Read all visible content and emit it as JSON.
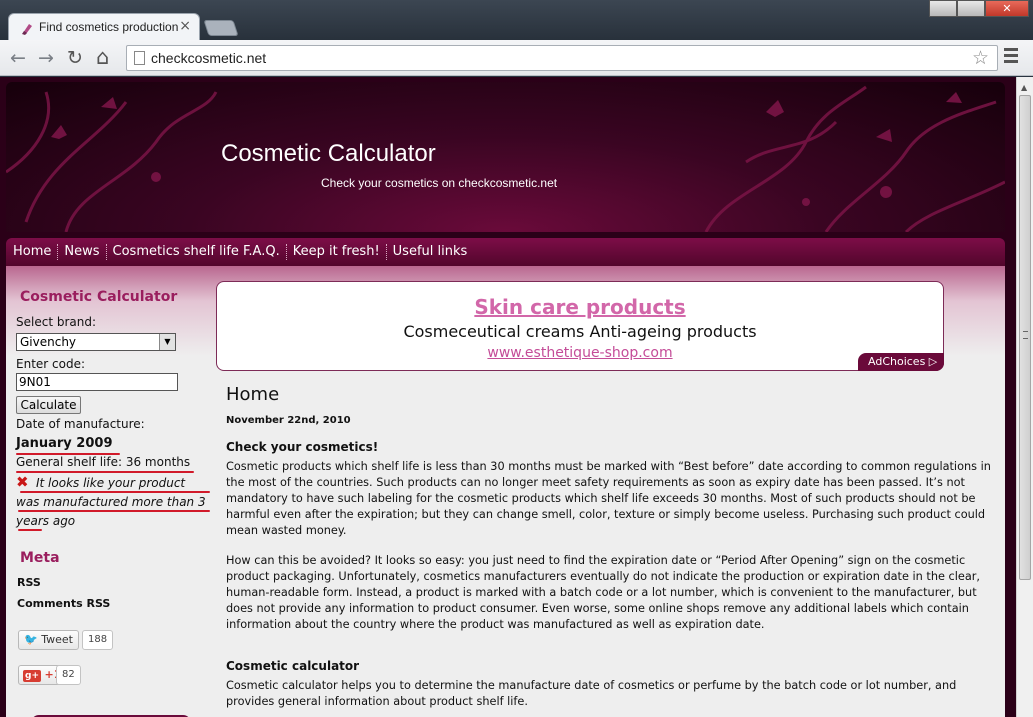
{
  "browser": {
    "tab_title": "Find cosmetics production",
    "tab_close": "×",
    "close_glyph": "✕",
    "url": "checkcosmetic.net",
    "back": "←",
    "forward": "→",
    "reload": "↻",
    "home": "⌂",
    "star": "☆"
  },
  "site": {
    "title": "Cosmetic Calculator",
    "tagline": "Check your cosmetics on checkcosmetic.net",
    "accent": "#9a1e5e"
  },
  "nav": {
    "items": [
      "Home",
      "News",
      "Cosmetics shelf life F.A.Q.",
      "Keep it fresh!",
      "Useful links"
    ]
  },
  "sidebar": {
    "title": "Cosmetic Calculator",
    "brand_label": "Select brand:",
    "brand_value": "Givenchy",
    "code_label": "Enter code:",
    "code_value": "9N01",
    "calculate_label": "Calculate",
    "date_label": "Date of manufacture:",
    "date_value": "January 2009",
    "shelf_life": "General shelf life: 36 months",
    "warning_icon": "✖",
    "warning": "It looks like your product was manufactured more than 3 years ago",
    "meta_title": "Meta",
    "rss": "RSS",
    "comments_rss": "Comments RSS",
    "tweet_label": "Tweet",
    "tweet_count": "188",
    "gplus_label": "+1",
    "gplus_g": "g+",
    "gplus_count": "82"
  },
  "ad": {
    "title": "Skin care products",
    "description": "Cosmeceutical creams Anti-ageing products",
    "url": "www.esthetique-shop.com",
    "choices": "AdChoices ▷"
  },
  "main": {
    "heading": "Home",
    "date": "November 22nd, 2010",
    "h_check": "Check your cosmetics!",
    "p1": "Cosmetic products which shelf life is less than 30 months must be marked with “Best before” date according to common regulations in the most of the countries. Such products can no longer meet safety requirements as soon as expiry date has been passed. It’s not mandatory to have such labeling for the cosmetic products which shelf life exceeds 30 months. Most of such products should not be harmful even after the expiration; but they can change smell, color, texture or simply become useless. Purchasing such product could mean wasted money.",
    "p2": "How can this be avoided? It looks so easy: you just need to find the expiration date or “Period After Opening” sign on the cosmetic product packaging. Unfortunately, cosmetics manufacturers eventually do not indicate the production or expiration date in the clear, human-readable form. Instead, a product is marked with a batch code or a lot number, which is convenient to the manufacturer, but does not provide any information to product consumer. Even worse, some online shops remove any additional labels which contain information about the country where the product was manufactured as well as expiration date.",
    "h_calc": "Cosmetic calculator",
    "p3": "Cosmetic calculator helps you to determine the manufacture date of cosmetics or perfume by the batch code or lot number, and provides general information about product shelf life."
  }
}
